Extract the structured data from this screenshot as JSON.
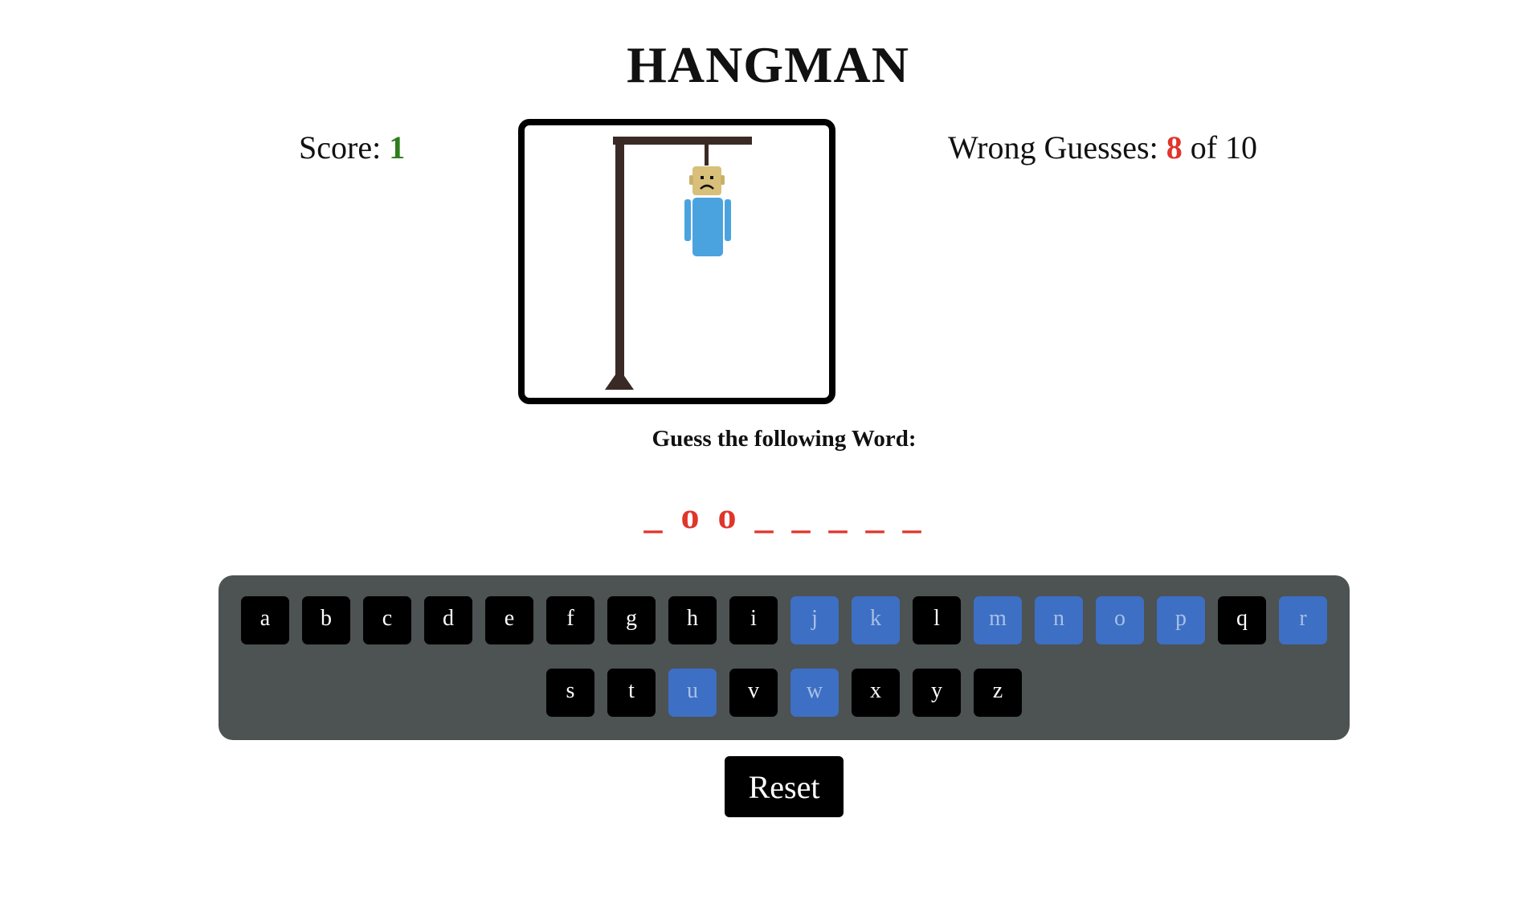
{
  "title": "HANGMAN",
  "score": {
    "label": "Score:",
    "value": "1",
    "value_color": "#2e7d1b"
  },
  "wrong_guesses": {
    "label": "Wrong Guesses:",
    "value": "8",
    "suffix": "of 10",
    "value_color": "#e0352b"
  },
  "prompt": "Guess the following Word:",
  "word": [
    "_",
    "o",
    "o",
    "_",
    "_",
    "_",
    "_",
    "_"
  ],
  "keyboard": {
    "keys": [
      {
        "letter": "a",
        "used": false
      },
      {
        "letter": "b",
        "used": false
      },
      {
        "letter": "c",
        "used": false
      },
      {
        "letter": "d",
        "used": false
      },
      {
        "letter": "e",
        "used": false
      },
      {
        "letter": "f",
        "used": false
      },
      {
        "letter": "g",
        "used": false
      },
      {
        "letter": "h",
        "used": false
      },
      {
        "letter": "i",
        "used": false
      },
      {
        "letter": "j",
        "used": true
      },
      {
        "letter": "k",
        "used": true
      },
      {
        "letter": "l",
        "used": false
      },
      {
        "letter": "m",
        "used": true
      },
      {
        "letter": "n",
        "used": true
      },
      {
        "letter": "o",
        "used": true
      },
      {
        "letter": "p",
        "used": true
      },
      {
        "letter": "q",
        "used": false
      },
      {
        "letter": "r",
        "used": true
      },
      {
        "letter": "s",
        "used": false
      },
      {
        "letter": "t",
        "used": false
      },
      {
        "letter": "u",
        "used": true
      },
      {
        "letter": "v",
        "used": false
      },
      {
        "letter": "w",
        "used": true
      },
      {
        "letter": "x",
        "used": false
      },
      {
        "letter": "y",
        "used": false
      },
      {
        "letter": "z",
        "used": false
      }
    ],
    "colors": {
      "panel": "#4d5252",
      "key": "#000000",
      "used_key": "#3d6fc4"
    }
  },
  "reset_label": "Reset",
  "hangman": {
    "parts_shown": [
      "head",
      "body",
      "left-arm",
      "right-arm"
    ],
    "body_color": "#4aa3df",
    "head_color": "#d8c07a"
  }
}
